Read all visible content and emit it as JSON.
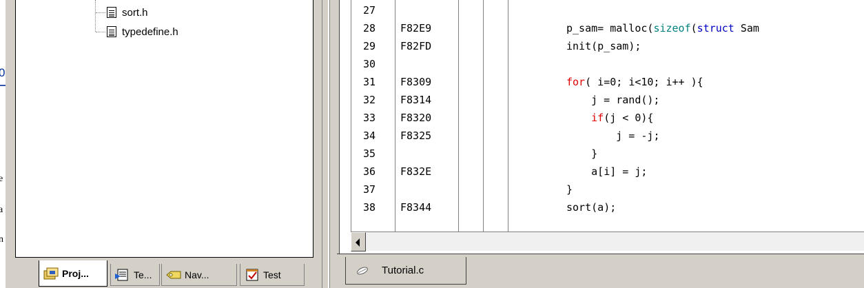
{
  "left_strip": {
    "fragments": [
      "0",
      "e",
      "a",
      "n"
    ]
  },
  "workspace": {
    "files": [
      {
        "name": "sort.h",
        "icon": "header-file-icon"
      },
      {
        "name": "typedefine.h",
        "icon": "header-file-icon"
      }
    ],
    "tabs": [
      {
        "label": "Proj...",
        "icon": "project-icon",
        "active": true
      },
      {
        "label": "Te...",
        "icon": "templates-icon",
        "active": false
      },
      {
        "label": "Nav...",
        "icon": "navigation-icon",
        "active": false
      },
      {
        "label": "Test",
        "icon": "test-icon",
        "active": false
      }
    ]
  },
  "editor": {
    "lines": [
      {
        "ln": "27",
        "addr": "",
        "src": ""
      },
      {
        "ln": "28",
        "addr": "F82E9",
        "src": "p_sam= malloc(sizeof(struct Sam"
      },
      {
        "ln": "29",
        "addr": "F82FD",
        "src": "init(p_sam);"
      },
      {
        "ln": "30",
        "addr": "",
        "src": ""
      },
      {
        "ln": "31",
        "addr": "F8309",
        "src": "for( i=0; i<10; i++ ){"
      },
      {
        "ln": "32",
        "addr": "F8314",
        "src": "    j = rand();"
      },
      {
        "ln": "33",
        "addr": "F8320",
        "src": "    if(j < 0){"
      },
      {
        "ln": "34",
        "addr": "F8325",
        "src": "        j = -j;"
      },
      {
        "ln": "35",
        "addr": "",
        "src": "    }"
      },
      {
        "ln": "36",
        "addr": "F832E",
        "src": "    a[i] = j;"
      },
      {
        "ln": "37",
        "addr": "",
        "src": "}"
      },
      {
        "ln": "38",
        "addr": "F8344",
        "src": "sort(a);"
      }
    ],
    "file_tab": {
      "label": "Tutorial.c",
      "icon": "source-file-icon"
    }
  },
  "colors": {
    "keyword": "#e00000",
    "builtin": "#008080",
    "type_keyword": "#0000c0",
    "chrome": "#d4d0c8"
  }
}
